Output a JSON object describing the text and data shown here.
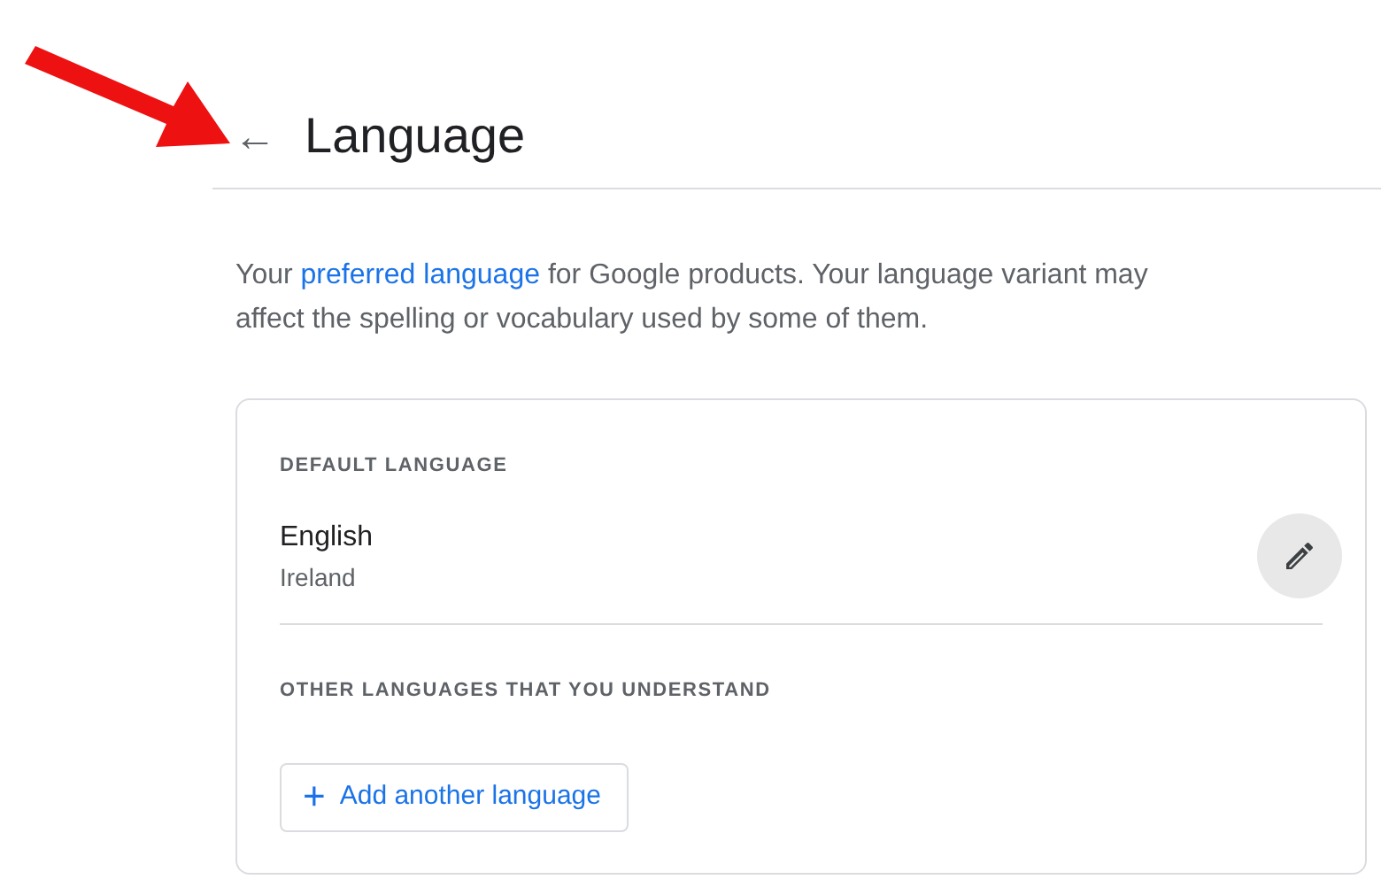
{
  "annotation": {
    "kind": "arrow"
  },
  "header": {
    "back_icon": "←",
    "title": "Language"
  },
  "intro": {
    "before": "Your ",
    "link": "preferred language",
    "after": " for Google products. Your language variant may affect the spelling or vocabulary used by some of them."
  },
  "card": {
    "default_label": "DEFAULT LANGUAGE",
    "default_language": {
      "name": "English",
      "region": "Ireland"
    },
    "other_label": "OTHER LANGUAGES THAT YOU UNDERSTAND",
    "add_button": {
      "icon": "+",
      "label": "Add another language"
    }
  }
}
